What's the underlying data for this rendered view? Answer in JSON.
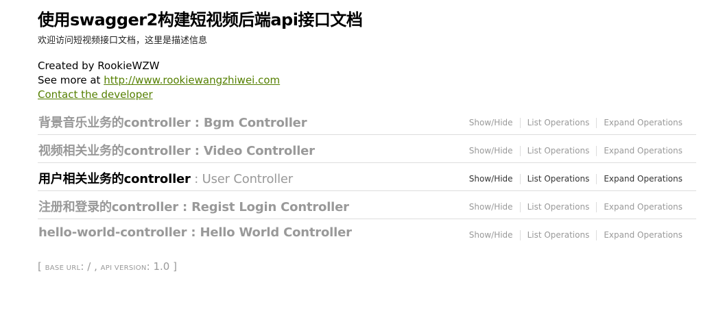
{
  "info": {
    "title": "使用swagger2构建短视频后端api接口文档",
    "description": "欢迎访问短视频接口文档，这里是描述信息",
    "created_by": "Created by RookieWZW",
    "see_more_prefix": "See more at ",
    "see_more_link": "http://www.rookiewangzhiwei.com",
    "contact": "Contact the developer"
  },
  "resources": [
    {
      "name": "背景音乐业务的controller",
      "separator": " : ",
      "desc": "Bgm Controller",
      "active": false
    },
    {
      "name": "视频相关业务的controller",
      "separator": " : ",
      "desc": "Video Controller",
      "active": false
    },
    {
      "name": "用户相关业务的controller",
      "separator": " : ",
      "desc": "User Controller",
      "active": true
    },
    {
      "name": "注册和登录的controller",
      "separator": " : ",
      "desc": "Regist Login Controller",
      "active": false
    },
    {
      "name": "hello-world-controller",
      "separator": " : ",
      "desc": "Hello World Controller",
      "active": false
    }
  ],
  "operations": {
    "show_hide": "Show/Hide",
    "list": "List Operations",
    "expand": "Expand Operations"
  },
  "footer": {
    "open": "[ ",
    "base_url_label": "base url",
    "base_url_value": ": / , ",
    "api_version_label": "api version",
    "api_version_value": ": 1.0 ]"
  }
}
